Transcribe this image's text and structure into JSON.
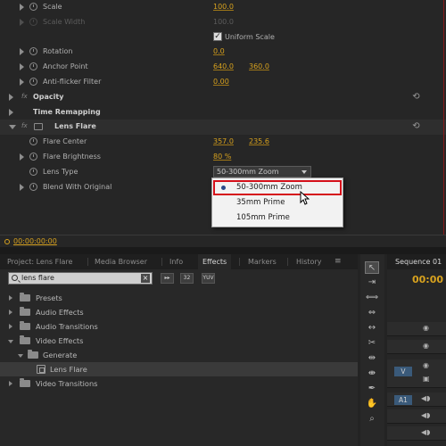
{
  "effect_controls": {
    "rows": [
      {
        "label": "Scale",
        "value": "100.0",
        "value2": "",
        "dim": false
      },
      {
        "label": "Scale Width",
        "value": "100.0",
        "value2": "",
        "dim": true
      },
      {
        "label": "Uniform Scale",
        "checked": true
      },
      {
        "label": "Rotation",
        "value": "0.0",
        "value2": ""
      },
      {
        "label": "Anchor Point",
        "value": "640.0",
        "value2": "360.0"
      },
      {
        "label": "Anti-flicker Filter",
        "value": "0.00",
        "value2": ""
      },
      {
        "label": "Opacity"
      },
      {
        "label": "Time Remapping"
      },
      {
        "label": "Lens Flare"
      },
      {
        "label": "Flare Center",
        "value": "357.0",
        "value2": "235.6"
      },
      {
        "label": "Flare Brightness",
        "value": "80 %",
        "value2": ""
      },
      {
        "label": "Lens Type",
        "value": "50-300mm Zoom"
      },
      {
        "label": "Blend With Original"
      }
    ],
    "fx_glyph": "fx",
    "timecode": "00:00:00:00",
    "dropdown": {
      "options": [
        "50-300mm Zoom",
        "35mm Prime",
        "105mm Prime"
      ],
      "selected_index": 0
    }
  },
  "project_panel": {
    "tabs": [
      "Project: Lens Flare",
      "Media Browser",
      "Info",
      "Effects",
      "Markers",
      "History"
    ],
    "active_tab": "Effects",
    "search_value": "lens flare",
    "filter_buttons": [
      "32",
      "YUV"
    ],
    "tree": [
      {
        "label": "Presets"
      },
      {
        "label": "Audio Effects"
      },
      {
        "label": "Audio Transitions"
      },
      {
        "label": "Video Effects"
      },
      {
        "label": "Generate"
      },
      {
        "label": "Lens Flare"
      },
      {
        "label": "Video Transitions"
      }
    ]
  },
  "sequence_panel": {
    "tab_label": "Sequence 01",
    "timecode": "00:00",
    "tracks": [
      {
        "label": ""
      },
      {
        "label": ""
      },
      {
        "label": "V"
      },
      {
        "label": "A1"
      },
      {
        "label": ""
      },
      {
        "label": ""
      }
    ]
  },
  "colors": {
    "accent_value": "#d8a21e",
    "highlight_border": "#d5101a",
    "panel_bg": "#262626"
  }
}
